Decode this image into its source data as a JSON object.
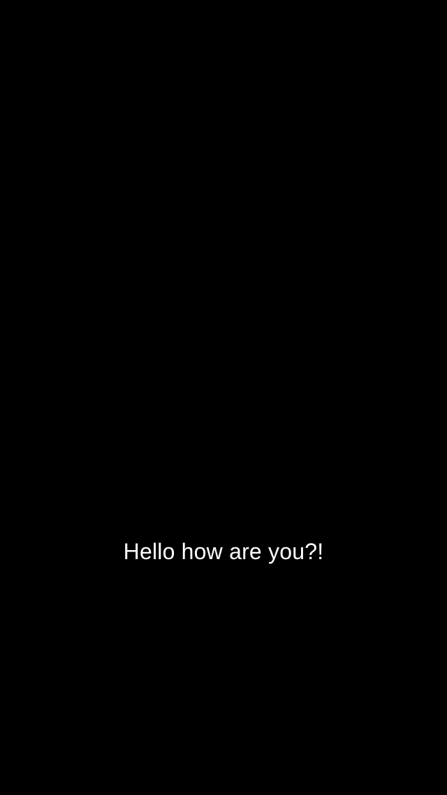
{
  "screen": {
    "background_color": "#000000",
    "text_color": "#ffffff",
    "message": "Hello how are you?!"
  }
}
